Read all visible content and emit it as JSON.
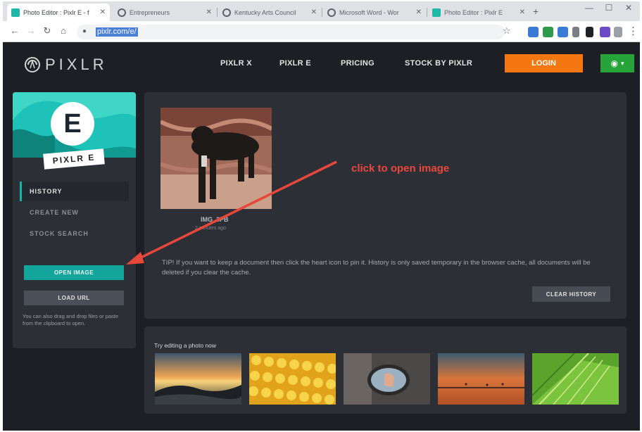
{
  "browser": {
    "tabs": [
      {
        "title": "Photo Editor : Pixlr E - f",
        "favicon_color": "#22b8a7",
        "active": true
      },
      {
        "title": "Entrepreneurs",
        "favicon_color": "#5f6368",
        "active": false
      },
      {
        "title": "Kentucky Arts Council",
        "favicon_color": "#5f6368",
        "active": false
      },
      {
        "title": "Microsoft Word - Wor",
        "favicon_color": "#5f6368",
        "active": false
      },
      {
        "title": "Photo Editor : Pixlr E",
        "favicon_color": "#22b8a7",
        "active": false
      }
    ],
    "new_tab_symbol": "+",
    "url": "pixlr.com/e/",
    "window_buttons": [
      "—",
      "☐",
      "✕"
    ]
  },
  "header": {
    "logo_text": "PIXLR",
    "nav": [
      "PIXLR X",
      "PIXLR E",
      "PRICING",
      "STOCK BY PIXLR"
    ],
    "login_label": "LOGIN",
    "colors": {
      "login": "#f57712",
      "globe": "#26a43a"
    }
  },
  "sidebar": {
    "badge_letter": "E",
    "badge_label": "PIXLR E",
    "items": [
      {
        "label": "HISTORY",
        "active": true
      },
      {
        "label": "CREATE NEW",
        "active": false
      },
      {
        "label": "STOCK SEARCH",
        "active": false
      }
    ],
    "open_image_label": "OPEN IMAGE",
    "load_url_label": "LOAD URL",
    "note": "You can also drag and drop files or paste from the clipboard to open."
  },
  "history": {
    "thumbnail_name": "IMG_3PB",
    "thumbnail_time": "2 minutes ago",
    "annotation": "click to open image",
    "tip": "TIP! If you want to keep a document then click the heart icon to pin it. History is only saved temporary in the browser cache, all documents will be deleted if you clear the cache.",
    "clear_label": "CLEAR HISTORY"
  },
  "try_panel": {
    "title": "Try editing a photo now",
    "samples": [
      "sunset-landscape",
      "yellow-balls",
      "side-mirror-hand",
      "orange-sky-sea",
      "green-palm-leaves"
    ]
  },
  "colors": {
    "accent": "#12a59c",
    "annotation": "#e8473c",
    "background": "#1d1f24",
    "panel": "#2c2f36"
  }
}
